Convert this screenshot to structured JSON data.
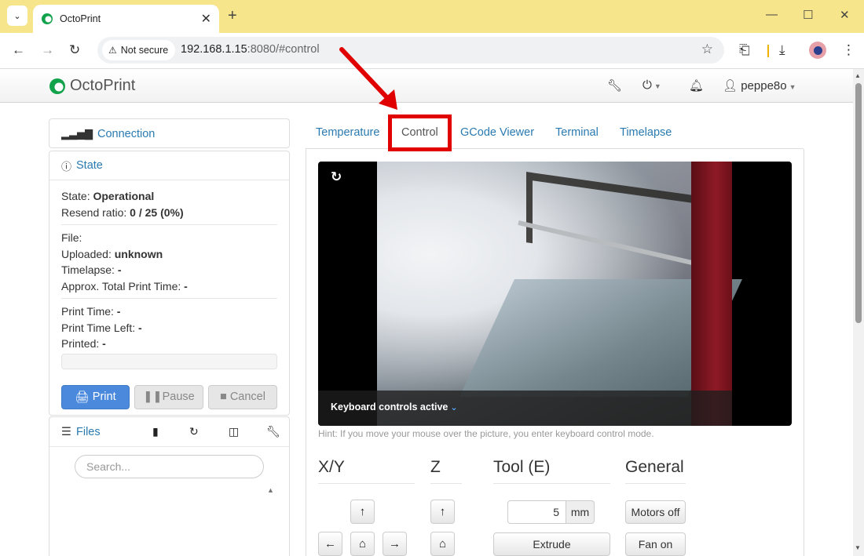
{
  "browser": {
    "tab_title": "OctoPrint",
    "new_tab": "+",
    "security_label": "Not secure",
    "url_host": "192.168.1.15",
    "url_rest": ":8080/#control",
    "window_controls": [
      "minimize",
      "maximize",
      "close"
    ]
  },
  "navbar": {
    "brand": "OctoPrint",
    "user": "peppe8o",
    "icons": [
      "wrench-icon",
      "power-icon",
      "bell-icon",
      "user-icon"
    ]
  },
  "sidebar": {
    "connection_label": "Connection",
    "state_label": "State",
    "state": {
      "state_key": "State:",
      "state_val": "Operational",
      "resend_key": "Resend ratio:",
      "resend_val": "0 / 25 (0%)",
      "file_key": "File:",
      "uploaded_key": "Uploaded:",
      "uploaded_val": "unknown",
      "timelapse_key": "Timelapse:",
      "timelapse_val": "-",
      "approx_key": "Approx. Total Print Time:",
      "approx_val": "-",
      "print_time_key": "Print Time:",
      "print_time_val": "-",
      "time_left_key": "Print Time Left:",
      "time_left_val": "-",
      "printed_key": "Printed:",
      "printed_val": "-",
      "progress": 0
    },
    "buttons": {
      "print": "Print",
      "pause": "Pause",
      "cancel": "Cancel"
    },
    "files_label": "Files",
    "search_placeholder": "Search..."
  },
  "main": {
    "tabs": [
      "Temperature",
      "Control",
      "GCode Viewer",
      "Terminal",
      "Timelapse"
    ],
    "active_tab": "Control",
    "webcam": {
      "keyboard_text": "Keyboard controls active"
    },
    "hint": "Hint: If you move your mouse over the picture, you enter keyboard control mode.",
    "columns": {
      "xy": "X/Y",
      "z": "Z",
      "tool": "Tool (E)",
      "general": "General"
    },
    "tool": {
      "amount": "5",
      "unit": "mm",
      "extrude": "Extrude"
    },
    "general": {
      "motors_off": "Motors off",
      "fan_on": "Fan on"
    }
  },
  "colors": {
    "link": "#2a7ab0",
    "print_button": "#4a89dc",
    "annotation_red": "#e00000",
    "tabbar": "#f7e58b"
  }
}
